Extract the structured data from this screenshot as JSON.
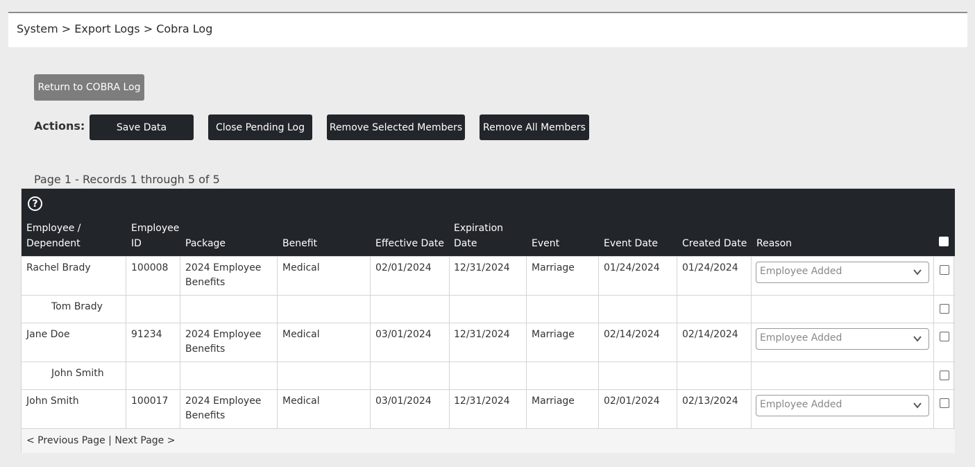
{
  "breadcrumb": "System > Export Logs > Cobra Log",
  "return_button": "Return to COBRA Log",
  "actions": {
    "label": "Actions:",
    "save": "Save Data",
    "close": "Close Pending Log",
    "remove_selected": "Remove Selected Members",
    "remove_all": "Remove All Members"
  },
  "paging_text": "Page 1 - Records 1 through 5 of 5",
  "table": {
    "help_icon": "question-circle-icon",
    "headers": {
      "employee_l1": "Employee /",
      "employee_l2": "Dependent",
      "id_l1": "Employee",
      "id_l2": "ID",
      "package": "Package",
      "benefit": "Benefit",
      "effective": "Effective Date",
      "expiration_l1": "Expiration",
      "expiration_l2": "Date",
      "event": "Event",
      "event_date": "Event Date",
      "created": "Created Date",
      "reason": "Reason"
    },
    "rows": [
      {
        "name": "Rachel Brady",
        "id": "100008",
        "package_l1": "2024 Employee",
        "package_l2": "Benefits",
        "benefit": "Medical",
        "effective": "02/01/2024",
        "expiration": "12/31/2024",
        "event": "Marriage",
        "event_date": "01/24/2024",
        "created": "01/24/2024",
        "reason": "Employee Added"
      },
      {
        "name": "Tom Brady"
      },
      {
        "name": "Jane Doe",
        "id": "91234",
        "package_l1": "2024 Employee",
        "package_l2": "Benefits",
        "benefit": "Medical",
        "effective": "03/01/2024",
        "expiration": "12/31/2024",
        "event": "Marriage",
        "event_date": "02/14/2024",
        "created": "02/14/2024",
        "reason": "Employee Added"
      },
      {
        "name": "John Smith"
      },
      {
        "name": "John Smith",
        "id": "100017",
        "package_l1": "2024 Employee",
        "package_l2": "Benefits",
        "benefit": "Medical",
        "effective": "03/01/2024",
        "expiration": "12/31/2024",
        "event": "Marriage",
        "event_date": "02/01/2024",
        "created": "02/13/2024",
        "reason": "Employee Added"
      }
    ],
    "footer": {
      "prev": "< Previous Page",
      "sep": " | ",
      "next": "Next Page >"
    }
  }
}
